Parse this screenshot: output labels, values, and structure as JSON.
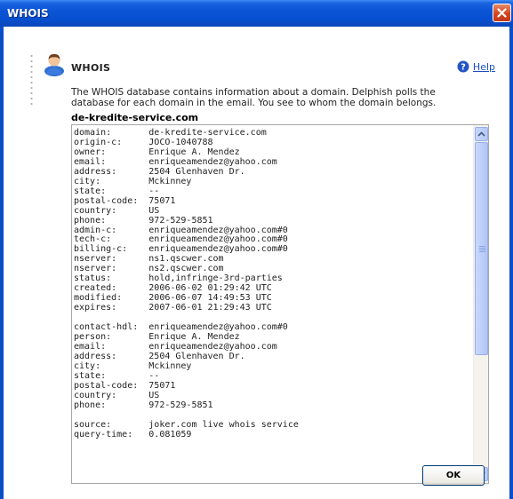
{
  "window": {
    "title": "WHOIS",
    "close_icon": "close-icon"
  },
  "header": {
    "icon": "user-icon",
    "title": "WHOIS",
    "help_label": "Help",
    "help_icon": "question-icon"
  },
  "description": "The WHOIS database contains information about a domain. Delphish polls the database for each domain in the email. You see to whom the domain belongs.",
  "domain": "de-kredite-service.com",
  "record_lines": [
    "domain:       de-kredite-service.com",
    "origin-c:     JOCO-1040788",
    "owner:        Enrique A. Mendez",
    "email:        enriqueamendez@yahoo.com",
    "address:      2504 Glenhaven Dr.",
    "city:         Mckinney",
    "state:        --",
    "postal-code:  75071",
    "country:      US",
    "phone:        972-529-5851",
    "admin-c:      enriqueamendez@yahoo.com#0",
    "tech-c:       enriqueamendez@yahoo.com#0",
    "billing-c:    enriqueamendez@yahoo.com#0",
    "nserver:      ns1.qscwer.com",
    "nserver:      ns2.qscwer.com",
    "status:       hold,infringe-3rd-parties",
    "created:      2006-06-02 01:29:42 UTC",
    "modified:     2006-06-07 14:49:53 UTC",
    "expires:      2007-06-01 21:29:43 UTC",
    "",
    "contact-hdl:  enriqueamendez@yahoo.com#0",
    "person:       Enrique A. Mendez",
    "email:        enriqueamendez@yahoo.com",
    "address:      2504 Glenhaven Dr.",
    "city:         Mckinney",
    "state:        --",
    "postal-code:  75071",
    "country:      US",
    "phone:        972-529-5851",
    "",
    "source:       joker.com live whois service",
    "query-time:   0.081059"
  ],
  "ok_label": "OK",
  "colors": {
    "titlebar": "#0a54d6",
    "link": "#1d4ebf",
    "close_button": "#d4451e"
  }
}
